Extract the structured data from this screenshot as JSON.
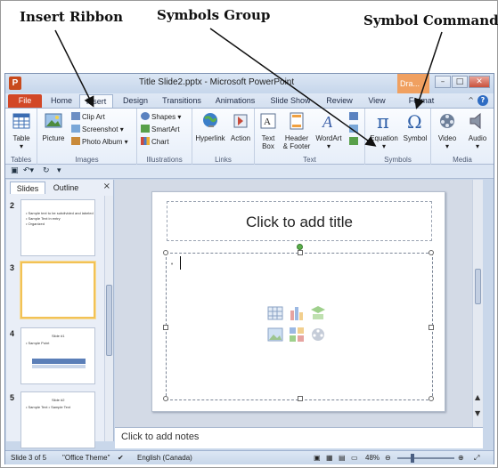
{
  "annotations": {
    "insert_ribbon": "Insert Ribbon",
    "symbols_group": "Symbols Group",
    "symbol_command": "Symbol Command"
  },
  "window": {
    "title": "Title Slide2.pptx - Microsoft PowerPoint",
    "contextual_tab": "Dra...",
    "logo": "P"
  },
  "tabs": [
    "File",
    "Home",
    "Insert",
    "Design",
    "Transitions",
    "Animations",
    "Slide Show",
    "Review",
    "View",
    "Format"
  ],
  "active_tab": "Insert",
  "ribbon": {
    "groups": {
      "tables": "Tables",
      "images": "Images",
      "illustrations": "Illustrations",
      "links": "Links",
      "text": "Text",
      "symbols": "Symbols",
      "media": "Media"
    },
    "buttons": {
      "table": "Table",
      "picture": "Picture",
      "clip_art": "Clip Art",
      "screenshot": "Screenshot",
      "photo_album": "Photo Album",
      "shapes": "Shapes",
      "smartart": "SmartArt",
      "chart": "Chart",
      "hyperlink": "Hyperlink",
      "action": "Action",
      "text_box_1": "Text",
      "text_box_2": "Box",
      "header_footer_1": "Header",
      "header_footer_2": "& Footer",
      "wordart": "WordArt",
      "equation": "Equation",
      "symbol": "Symbol",
      "video": "Video",
      "audio": "Audio"
    }
  },
  "panes": {
    "slides_tab": "Slides",
    "outline_tab": "Outline",
    "close": "×"
  },
  "thumbnails": [
    {
      "num": "2",
      "lines": [
        "• Sample text to be subdivided and labeled",
        "• Sample Text in entry",
        "• Organized"
      ]
    },
    {
      "num": "3",
      "lines": []
    },
    {
      "num": "4",
      "title": "Slide #1",
      "lines": [
        "• Sample Point"
      ]
    },
    {
      "num": "5",
      "title": "Slide #2",
      "lines": [
        "• Sample Text       • Sample Text"
      ]
    }
  ],
  "slide": {
    "title_placeholder": "Click to add title",
    "bullet": "•"
  },
  "notes": "Click to add notes",
  "status": {
    "slide_info": "Slide 3 of 5",
    "theme": "\"Office Theme\"",
    "language": "English (Canada)",
    "zoom": "48%"
  }
}
